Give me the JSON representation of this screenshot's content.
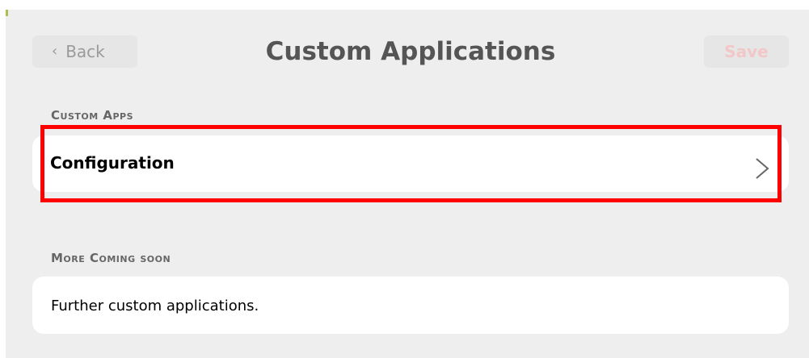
{
  "header": {
    "back_label": "Back",
    "title": "Custom Applications",
    "save_label": "Save"
  },
  "sections": [
    {
      "header": "Custom Apps",
      "items": [
        {
          "label": "Configuration",
          "icon": "chevron-right-icon",
          "highlighted": true
        }
      ]
    },
    {
      "header": "More Coming soon",
      "items": [
        {
          "label": "Further custom applications."
        }
      ]
    }
  ],
  "colors": {
    "panel_bg": "#eeeeee",
    "row_bg": "#ffffff",
    "title_text": "#555555",
    "section_header_text": "#666666",
    "save_disabled_text": "#f2c7c7",
    "highlight_border": "#ff0000"
  }
}
